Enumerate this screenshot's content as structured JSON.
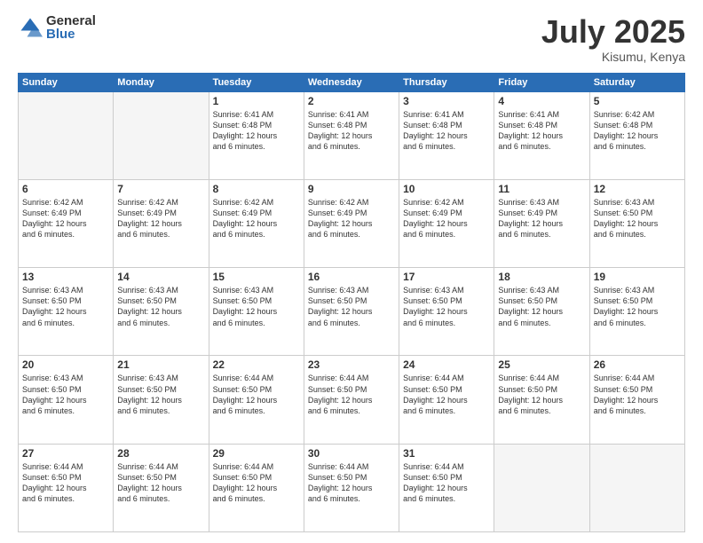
{
  "header": {
    "logo_general": "General",
    "logo_blue": "Blue",
    "title": "July 2025",
    "location": "Kisumu, Kenya"
  },
  "days_of_week": [
    "Sunday",
    "Monday",
    "Tuesday",
    "Wednesday",
    "Thursday",
    "Friday",
    "Saturday"
  ],
  "weeks": [
    [
      {
        "day": "",
        "info": ""
      },
      {
        "day": "",
        "info": ""
      },
      {
        "day": "1",
        "info": "Sunrise: 6:41 AM\nSunset: 6:48 PM\nDaylight: 12 hours\nand 6 minutes."
      },
      {
        "day": "2",
        "info": "Sunrise: 6:41 AM\nSunset: 6:48 PM\nDaylight: 12 hours\nand 6 minutes."
      },
      {
        "day": "3",
        "info": "Sunrise: 6:41 AM\nSunset: 6:48 PM\nDaylight: 12 hours\nand 6 minutes."
      },
      {
        "day": "4",
        "info": "Sunrise: 6:41 AM\nSunset: 6:48 PM\nDaylight: 12 hours\nand 6 minutes."
      },
      {
        "day": "5",
        "info": "Sunrise: 6:42 AM\nSunset: 6:48 PM\nDaylight: 12 hours\nand 6 minutes."
      }
    ],
    [
      {
        "day": "6",
        "info": "Sunrise: 6:42 AM\nSunset: 6:49 PM\nDaylight: 12 hours\nand 6 minutes."
      },
      {
        "day": "7",
        "info": "Sunrise: 6:42 AM\nSunset: 6:49 PM\nDaylight: 12 hours\nand 6 minutes."
      },
      {
        "day": "8",
        "info": "Sunrise: 6:42 AM\nSunset: 6:49 PM\nDaylight: 12 hours\nand 6 minutes."
      },
      {
        "day": "9",
        "info": "Sunrise: 6:42 AM\nSunset: 6:49 PM\nDaylight: 12 hours\nand 6 minutes."
      },
      {
        "day": "10",
        "info": "Sunrise: 6:42 AM\nSunset: 6:49 PM\nDaylight: 12 hours\nand 6 minutes."
      },
      {
        "day": "11",
        "info": "Sunrise: 6:43 AM\nSunset: 6:49 PM\nDaylight: 12 hours\nand 6 minutes."
      },
      {
        "day": "12",
        "info": "Sunrise: 6:43 AM\nSunset: 6:50 PM\nDaylight: 12 hours\nand 6 minutes."
      }
    ],
    [
      {
        "day": "13",
        "info": "Sunrise: 6:43 AM\nSunset: 6:50 PM\nDaylight: 12 hours\nand 6 minutes."
      },
      {
        "day": "14",
        "info": "Sunrise: 6:43 AM\nSunset: 6:50 PM\nDaylight: 12 hours\nand 6 minutes."
      },
      {
        "day": "15",
        "info": "Sunrise: 6:43 AM\nSunset: 6:50 PM\nDaylight: 12 hours\nand 6 minutes."
      },
      {
        "day": "16",
        "info": "Sunrise: 6:43 AM\nSunset: 6:50 PM\nDaylight: 12 hours\nand 6 minutes."
      },
      {
        "day": "17",
        "info": "Sunrise: 6:43 AM\nSunset: 6:50 PM\nDaylight: 12 hours\nand 6 minutes."
      },
      {
        "day": "18",
        "info": "Sunrise: 6:43 AM\nSunset: 6:50 PM\nDaylight: 12 hours\nand 6 minutes."
      },
      {
        "day": "19",
        "info": "Sunrise: 6:43 AM\nSunset: 6:50 PM\nDaylight: 12 hours\nand 6 minutes."
      }
    ],
    [
      {
        "day": "20",
        "info": "Sunrise: 6:43 AM\nSunset: 6:50 PM\nDaylight: 12 hours\nand 6 minutes."
      },
      {
        "day": "21",
        "info": "Sunrise: 6:43 AM\nSunset: 6:50 PM\nDaylight: 12 hours\nand 6 minutes."
      },
      {
        "day": "22",
        "info": "Sunrise: 6:44 AM\nSunset: 6:50 PM\nDaylight: 12 hours\nand 6 minutes."
      },
      {
        "day": "23",
        "info": "Sunrise: 6:44 AM\nSunset: 6:50 PM\nDaylight: 12 hours\nand 6 minutes."
      },
      {
        "day": "24",
        "info": "Sunrise: 6:44 AM\nSunset: 6:50 PM\nDaylight: 12 hours\nand 6 minutes."
      },
      {
        "day": "25",
        "info": "Sunrise: 6:44 AM\nSunset: 6:50 PM\nDaylight: 12 hours\nand 6 minutes."
      },
      {
        "day": "26",
        "info": "Sunrise: 6:44 AM\nSunset: 6:50 PM\nDaylight: 12 hours\nand 6 minutes."
      }
    ],
    [
      {
        "day": "27",
        "info": "Sunrise: 6:44 AM\nSunset: 6:50 PM\nDaylight: 12 hours\nand 6 minutes."
      },
      {
        "day": "28",
        "info": "Sunrise: 6:44 AM\nSunset: 6:50 PM\nDaylight: 12 hours\nand 6 minutes."
      },
      {
        "day": "29",
        "info": "Sunrise: 6:44 AM\nSunset: 6:50 PM\nDaylight: 12 hours\nand 6 minutes."
      },
      {
        "day": "30",
        "info": "Sunrise: 6:44 AM\nSunset: 6:50 PM\nDaylight: 12 hours\nand 6 minutes."
      },
      {
        "day": "31",
        "info": "Sunrise: 6:44 AM\nSunset: 6:50 PM\nDaylight: 12 hours\nand 6 minutes."
      },
      {
        "day": "",
        "info": ""
      },
      {
        "day": "",
        "info": ""
      }
    ]
  ]
}
